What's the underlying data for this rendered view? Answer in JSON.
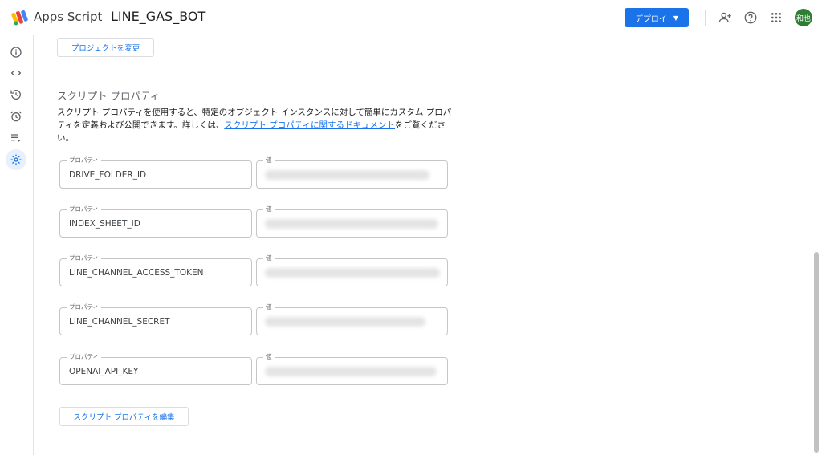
{
  "header": {
    "app_name": "Apps Script",
    "project_title": "LINE_GAS_BOT",
    "deploy_label": "デプロイ",
    "avatar_text": "和也"
  },
  "icons": {
    "logo": "apps-script-logo",
    "rail": [
      "info-icon",
      "code-icon",
      "history-icon",
      "alarm-icon",
      "executions-icon",
      "settings-icon"
    ],
    "top": [
      "add-person-icon",
      "help-icon",
      "apps-grid-icon"
    ]
  },
  "main": {
    "change_project_label": "プロジェクトを変更",
    "section_title": "スクリプト プロパティ",
    "description_prefix": "スクリプト プロパティを使用すると、特定のオブジェクト インスタンスに対して簡単にカスタム プロパティを定義および公開できます。詳しくは、",
    "description_link": "スクリプト プロパティに関するドキュメント",
    "description_suffix": "をご覧ください。",
    "property_label": "プロパティ",
    "value_label": "値",
    "properties": [
      {
        "key": "DRIVE_FOLDER_ID"
      },
      {
        "key": "INDEX_SHEET_ID"
      },
      {
        "key": "LINE_CHANNEL_ACCESS_TOKEN"
      },
      {
        "key": "LINE_CHANNEL_SECRET"
      },
      {
        "key": "OPENAI_API_KEY"
      }
    ],
    "edit_label": "スクリプト プロパティを編集"
  },
  "colors": {
    "accent": "#1a73e8",
    "avatar": "#2e7d32"
  }
}
